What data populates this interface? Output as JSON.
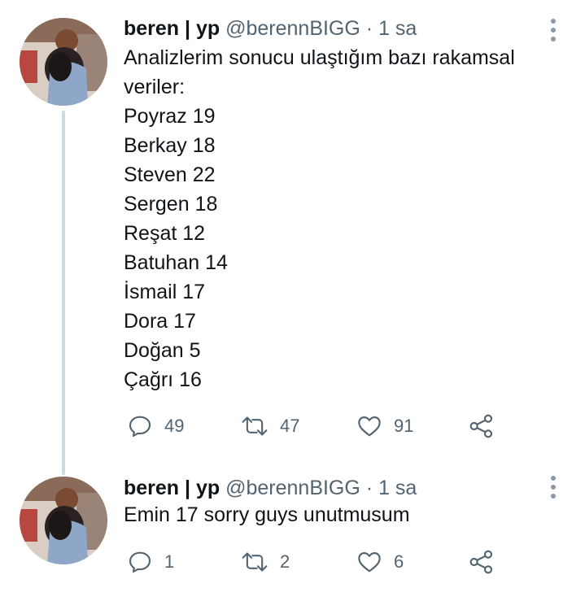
{
  "tweets": [
    {
      "author_name": "beren | yp",
      "handle": "@berennBIGG",
      "separator": "·",
      "time": "1 sa",
      "text_lines": [
        "Analizlerim sonucu ulaştığım bazı rakamsal",
        "veriler:",
        "Poyraz 19",
        "Berkay 18",
        "Steven 22",
        "Sergen 18",
        "Reşat 12",
        "Batuhan 14",
        "İsmail 17",
        "Dora 17",
        "Doğan 5",
        "Çağrı 16"
      ],
      "reply_count": "49",
      "retweet_count": "47",
      "like_count": "91"
    },
    {
      "author_name": "beren | yp",
      "handle": "@berennBIGG",
      "separator": "·",
      "time": "1 sa",
      "text_lines": [
        "Emin 17 sorry guys unutmusum"
      ],
      "reply_count": "1",
      "retweet_count": "2",
      "like_count": "6"
    }
  ],
  "icons": {
    "reply": "reply-icon",
    "retweet": "retweet-icon",
    "like": "heart-icon",
    "share": "share-icon",
    "more": "more-vertical-icon"
  },
  "colors": {
    "text": "#0f1419",
    "secondary": "#536471",
    "thread_line": "#cfd9de"
  }
}
